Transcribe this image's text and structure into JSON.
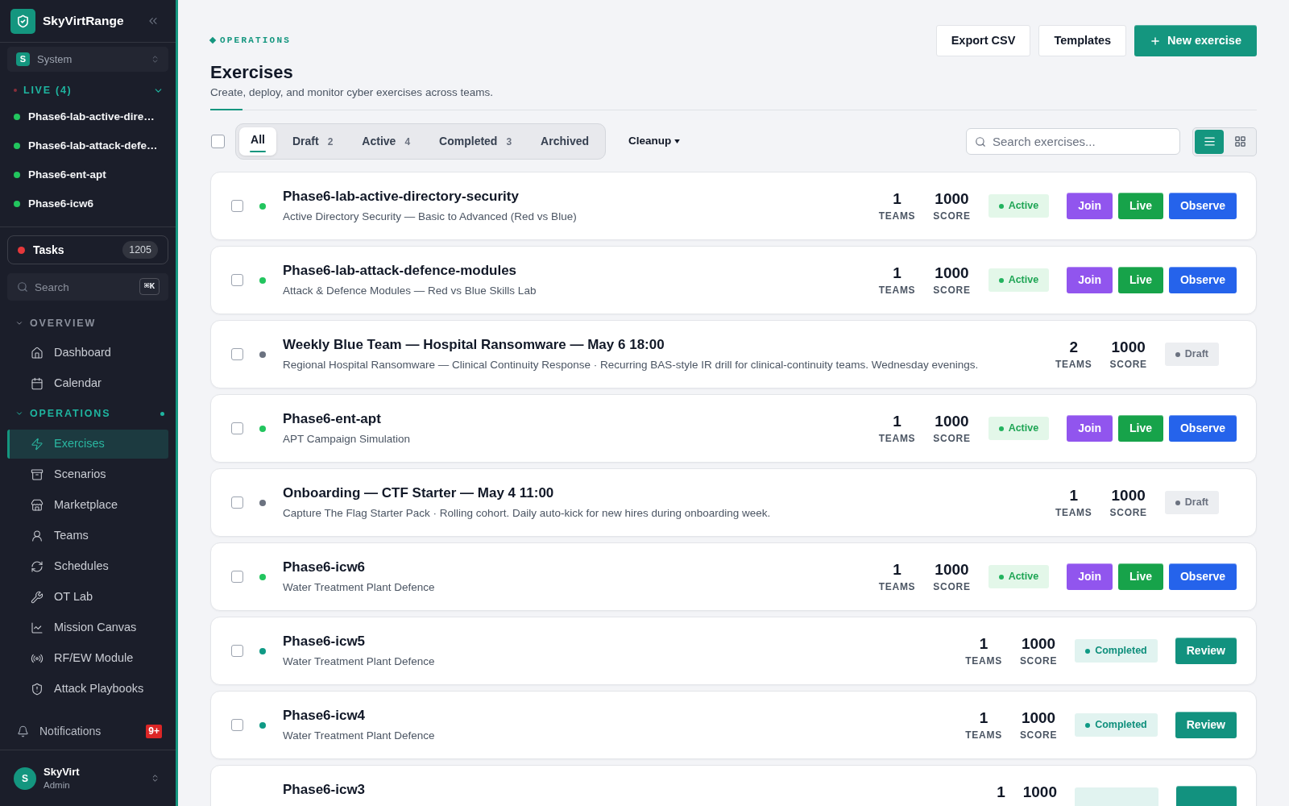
{
  "sidebar": {
    "brand": "SkyVirtRange",
    "workspace": {
      "initial": "S",
      "name": "System"
    },
    "live": {
      "title": "LIVE (4)",
      "expanded": true,
      "items": [
        {
          "label": "Phase6-lab-active-dire…"
        },
        {
          "label": "Phase6-lab-attack-defe…"
        },
        {
          "label": "Phase6-ent-apt"
        },
        {
          "label": "Phase6-icw6"
        }
      ]
    },
    "tasks": {
      "label": "Tasks",
      "count": "1205"
    },
    "search": {
      "placeholder": "Search",
      "shortcut": "⌘K"
    },
    "sections": [
      {
        "title": "OVERVIEW",
        "expanded": true,
        "indicator": false,
        "items": [
          {
            "label": "Dashboard",
            "selected": false
          },
          {
            "label": "Calendar",
            "selected": false
          }
        ]
      },
      {
        "title": "OPERATIONS",
        "expanded": true,
        "indicator": true,
        "items": [
          {
            "label": "Exercises",
            "selected": true
          },
          {
            "label": "Scenarios",
            "selected": false
          },
          {
            "label": "Marketplace",
            "selected": false
          },
          {
            "label": "Teams",
            "selected": false
          },
          {
            "label": "Schedules",
            "selected": false
          },
          {
            "label": "OT Lab",
            "selected": false
          },
          {
            "label": "Mission Canvas",
            "selected": false
          },
          {
            "label": "RF/EW Module",
            "selected": false
          },
          {
            "label": "Attack Playbooks",
            "selected": false
          }
        ]
      }
    ],
    "notifications": {
      "label": "Notifications",
      "badge": "9+"
    },
    "user": {
      "initial": "S",
      "name": "SkyVirt",
      "role": "Admin"
    }
  },
  "header": {
    "eyebrow": "OPERATIONS",
    "title": "Exercises",
    "subtitle": "Create, deploy, and monitor cyber exercises across teams.",
    "actions": [
      {
        "label": "Export CSV",
        "kind": "secondary"
      },
      {
        "label": "Templates",
        "kind": "secondary"
      },
      {
        "label": "New exercise",
        "kind": "primary"
      }
    ]
  },
  "toolbar": {
    "select_all": {
      "checked": false
    },
    "tabs": [
      {
        "label": "All",
        "selected": true
      },
      {
        "label": "Draft",
        "count": "2",
        "selected": false
      },
      {
        "label": "Active",
        "count": "4",
        "selected": false
      },
      {
        "label": "Completed",
        "count": "3",
        "selected": false
      },
      {
        "label": "Archived",
        "selected": false
      }
    ],
    "cleanup": {
      "label": "Cleanup"
    },
    "search": {
      "placeholder": "Search exercises..."
    },
    "views": [
      {
        "kind": "list",
        "selected": true
      },
      {
        "kind": "grid",
        "selected": false
      }
    ]
  },
  "rows": [
    {
      "title": "Phase6-lab-active-directory-security",
      "subtitle": "Active Directory Security — Basic to Advanced (Red vs Blue)",
      "checked": false,
      "kind": "active",
      "status_label": "Active",
      "teams": "1",
      "teams_label": "TEAMS",
      "score": "1000",
      "score_label": "SCORE",
      "actions": [
        {
          "label": "Join",
          "kind": "join"
        },
        {
          "label": "Live",
          "kind": "live"
        },
        {
          "label": "Observe",
          "kind": "observe"
        }
      ]
    },
    {
      "title": "Phase6-lab-attack-defence-modules",
      "subtitle": "Attack & Defence Modules — Red vs Blue Skills Lab",
      "checked": false,
      "kind": "active",
      "status_label": "Active",
      "teams": "1",
      "teams_label": "TEAMS",
      "score": "1000",
      "score_label": "SCORE",
      "actions": [
        {
          "label": "Join",
          "kind": "join"
        },
        {
          "label": "Live",
          "kind": "live"
        },
        {
          "label": "Observe",
          "kind": "observe"
        }
      ]
    },
    {
      "title": "Weekly Blue Team — Hospital Ransomware — May 6 18:00",
      "subtitle": "Regional Hospital Ransomware — Clinical Continuity Response · Recurring BAS-style IR drill for clinical-continuity teams. Wednesday evenings.",
      "checked": false,
      "kind": "draft",
      "status_label": "Draft",
      "teams": "2",
      "teams_label": "TEAMS",
      "score": "1000",
      "score_label": "SCORE"
    },
    {
      "title": "Phase6-ent-apt",
      "subtitle": "APT Campaign Simulation",
      "checked": false,
      "kind": "active",
      "status_label": "Active",
      "teams": "1",
      "teams_label": "TEAMS",
      "score": "1000",
      "score_label": "SCORE",
      "actions": [
        {
          "label": "Join",
          "kind": "join"
        },
        {
          "label": "Live",
          "kind": "live"
        },
        {
          "label": "Observe",
          "kind": "observe"
        }
      ]
    },
    {
      "title": "Onboarding — CTF Starter — May 4 11:00",
      "subtitle": "Capture The Flag Starter Pack · Rolling cohort. Daily auto-kick for new hires during onboarding week.",
      "checked": false,
      "kind": "draft",
      "status_label": "Draft",
      "teams": "1",
      "teams_label": "TEAMS",
      "score": "1000",
      "score_label": "SCORE"
    },
    {
      "title": "Phase6-icw6",
      "subtitle": "Water Treatment Plant Defence",
      "checked": false,
      "kind": "active",
      "status_label": "Active",
      "teams": "1",
      "teams_label": "TEAMS",
      "score": "1000",
      "score_label": "SCORE",
      "actions": [
        {
          "label": "Join",
          "kind": "join"
        },
        {
          "label": "Live",
          "kind": "live"
        },
        {
          "label": "Observe",
          "kind": "observe"
        }
      ]
    },
    {
      "title": "Phase6-icw5",
      "subtitle": "Water Treatment Plant Defence",
      "checked": false,
      "kind": "completed",
      "status_label": "Completed",
      "teams": "1",
      "teams_label": "TEAMS",
      "score": "1000",
      "score_label": "SCORE",
      "actions": [
        {
          "label": "Review",
          "kind": "review"
        }
      ]
    },
    {
      "title": "Phase6-icw4",
      "subtitle": "Water Treatment Plant Defence",
      "checked": false,
      "kind": "completed",
      "status_label": "Completed",
      "teams": "1",
      "teams_label": "TEAMS",
      "score": "1000",
      "score_label": "SCORE",
      "actions": [
        {
          "label": "Review",
          "kind": "review"
        }
      ]
    },
    {
      "title": "Phase6-icw3",
      "kind": "completed",
      "teams": "1",
      "score": "1000",
      "actions": [
        {
          "kind": "review"
        }
      ]
    }
  ]
}
